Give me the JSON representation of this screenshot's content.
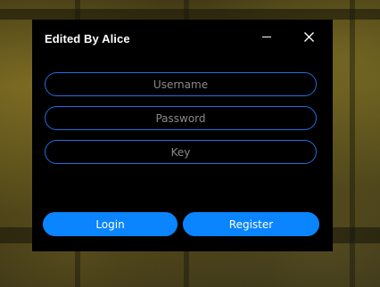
{
  "window": {
    "title": "Edited By Alice",
    "minimize_icon": "minimize-icon",
    "close_icon": "close-icon",
    "accent_color": "#0a84ff",
    "field_border_color": "#1f6fe0"
  },
  "form": {
    "username": {
      "placeholder": "Username",
      "value": ""
    },
    "password": {
      "placeholder": "Password",
      "value": ""
    },
    "key": {
      "placeholder": "Key",
      "value": ""
    }
  },
  "actions": {
    "login_label": "Login",
    "register_label": "Register"
  }
}
